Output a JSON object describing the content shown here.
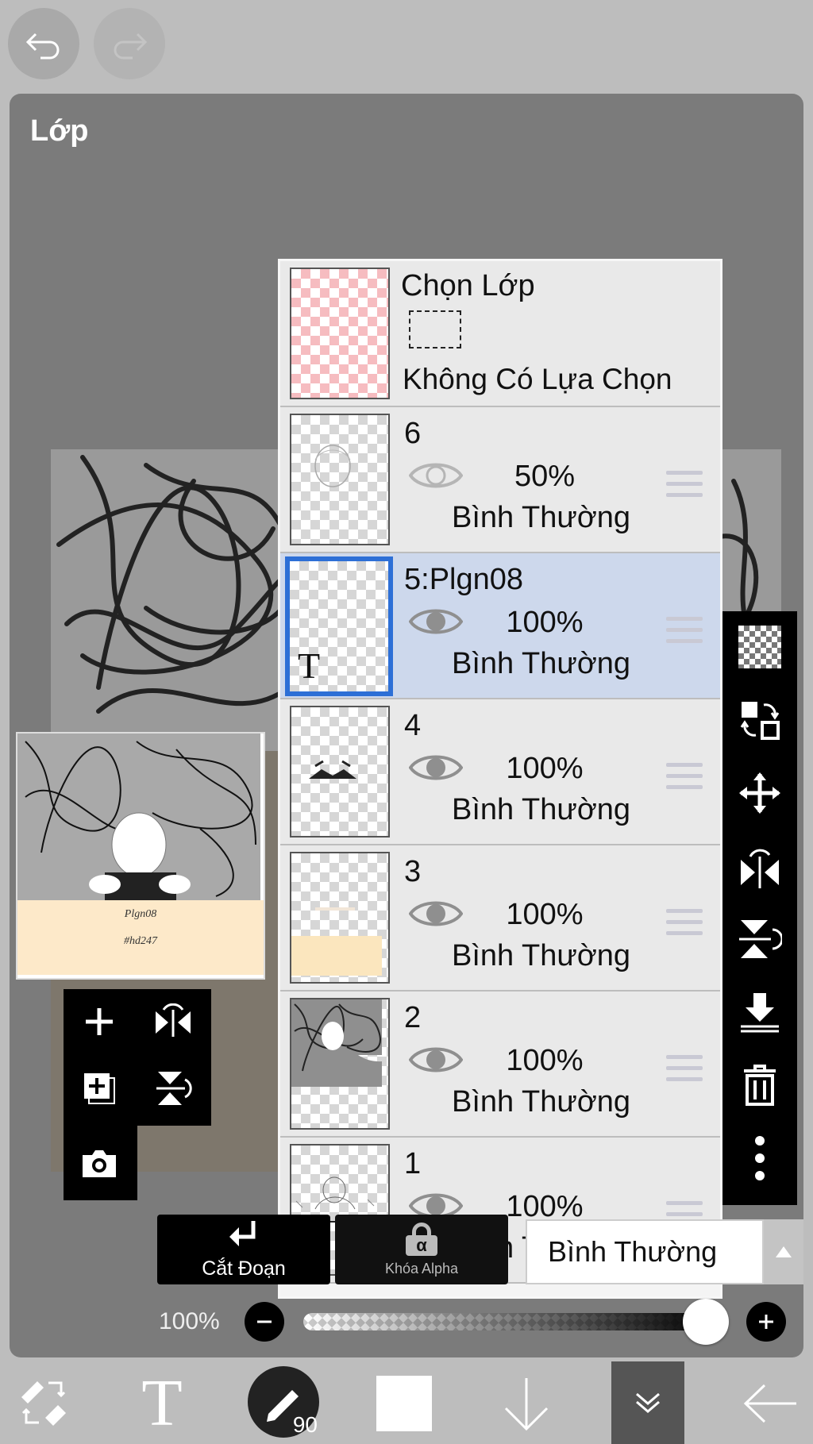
{
  "panel": {
    "title": "Lớp"
  },
  "selection_layer": {
    "title": "Chọn Lớp",
    "subtitle": "Không Có Lựa Chọn"
  },
  "layers": [
    {
      "name": "6",
      "opacity": "50%",
      "blend": "Bình Thường",
      "selected": false,
      "visible": true
    },
    {
      "name": "5:Plgn08",
      "opacity": "100%",
      "blend": "Bình Thường",
      "selected": true,
      "visible": true,
      "thumb_text": "T"
    },
    {
      "name": "4",
      "opacity": "100%",
      "blend": "Bình Thường",
      "selected": false,
      "visible": true
    },
    {
      "name": "3",
      "opacity": "100%",
      "blend": "Bình Thường",
      "selected": false,
      "visible": true
    },
    {
      "name": "2",
      "opacity": "100%",
      "blend": "Bình Thường",
      "selected": false,
      "visible": true
    },
    {
      "name": "1",
      "opacity": "100%",
      "blend": "Bình Thường",
      "selected": false,
      "visible": true
    }
  ],
  "preview": {
    "line1": "Plgn08",
    "line2": "#hd247"
  },
  "controls": {
    "clipping_label": "Cắt Đoạn",
    "alpha_lock_label": "Khóa Alpha",
    "alpha_symbol": "α",
    "blend_mode": "Bình Thường",
    "opacity_label": "100%",
    "opacity_value": 1.0
  },
  "bottom_bar": {
    "brush_size": "90"
  },
  "right_toolbar": [
    "checker-icon",
    "swap-layer-icon",
    "move-icon",
    "flip-horizontal-icon",
    "flip-vertical-icon",
    "merge-down-icon",
    "trash-icon",
    "more-icon"
  ],
  "colors": {
    "selected_row": "#cdd8ec",
    "accent": "#2d6fd6",
    "toolbar": "#000000"
  }
}
